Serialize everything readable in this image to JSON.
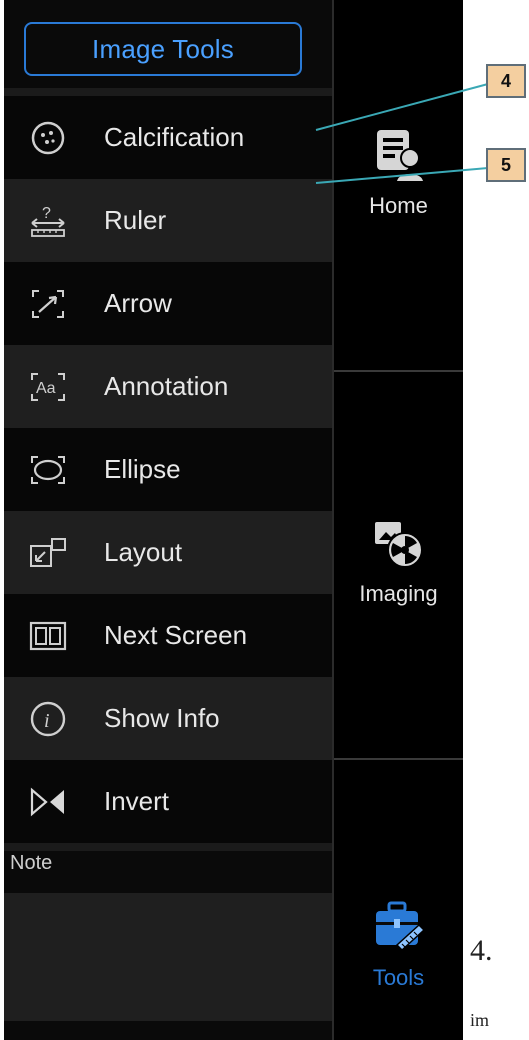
{
  "panel": {
    "title": "Image Tools",
    "items": [
      {
        "label": "Calcification",
        "icon": "calcification-icon"
      },
      {
        "label": "Ruler",
        "icon": "ruler-icon"
      },
      {
        "label": "Arrow",
        "icon": "arrow-icon"
      },
      {
        "label": "Annotation",
        "icon": "annotation-icon"
      },
      {
        "label": "Ellipse",
        "icon": "ellipse-icon"
      },
      {
        "label": "Layout",
        "icon": "layout-icon"
      },
      {
        "label": "Next Screen",
        "icon": "next-screen-icon"
      },
      {
        "label": "Show Info",
        "icon": "info-icon"
      },
      {
        "label": "Invert",
        "icon": "invert-icon"
      }
    ],
    "note_label": "Note"
  },
  "nav": {
    "home": "Home",
    "imaging": "Imaging",
    "tools": "Tools"
  },
  "callouts": [
    "4",
    "5"
  ],
  "page_text": {
    "number": "4.",
    "word": "im"
  },
  "colors": {
    "accent": "#2a7ad6",
    "callout_fill": "#f4cfa0",
    "callout_line": "#3aa8b5"
  }
}
